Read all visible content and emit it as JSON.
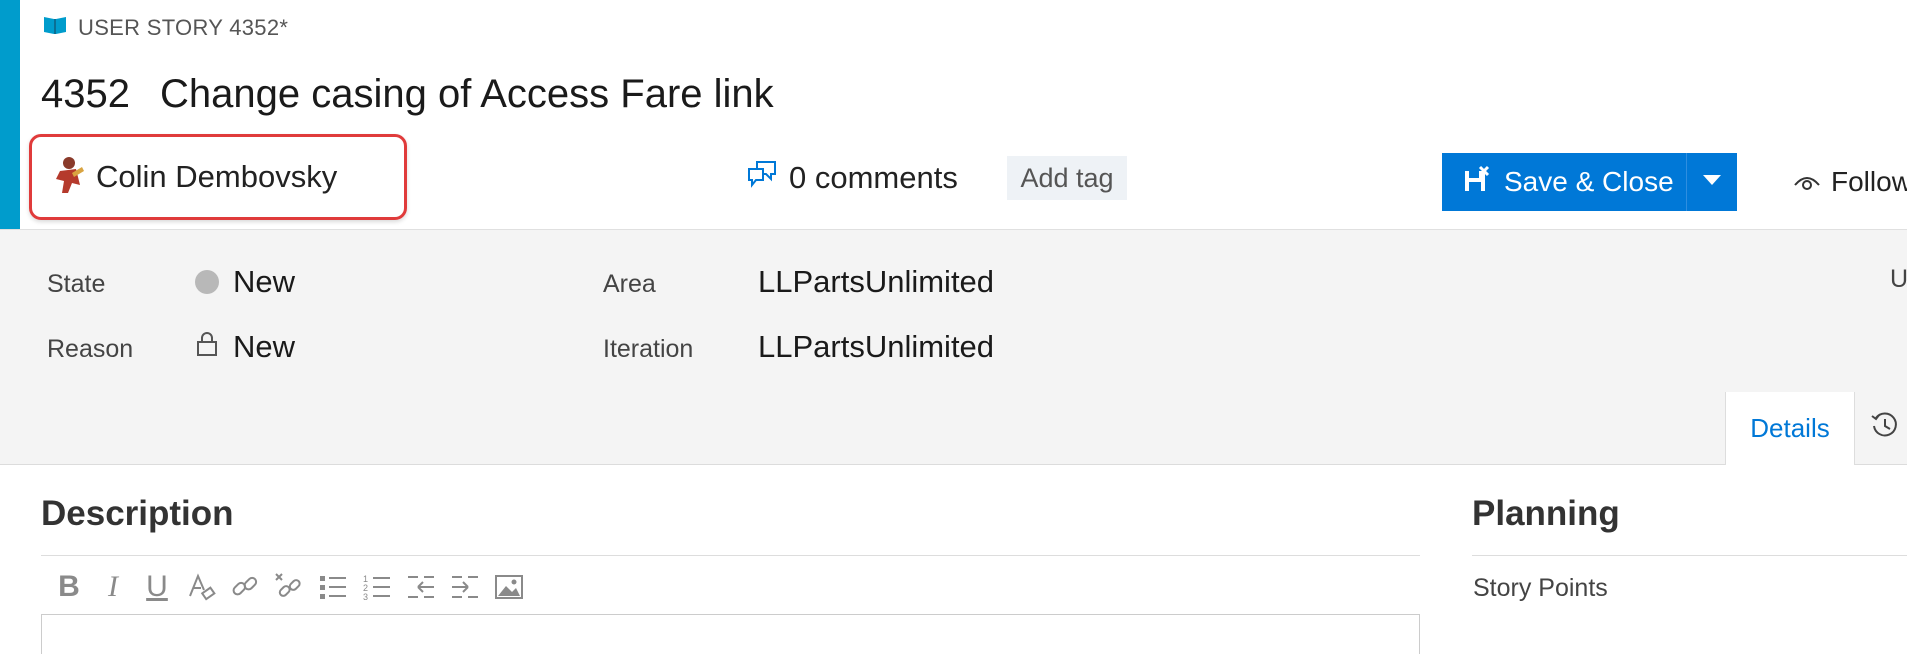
{
  "header": {
    "type_label": "USER STORY 4352*",
    "id": "4352",
    "title": "Change casing of Access Fare link",
    "assignee": "Colin Dembovsky",
    "comments": "0 comments",
    "add_tag": "Add tag",
    "save_label": "Save & Close",
    "follow_label": "Follow"
  },
  "fields": {
    "state_label": "State",
    "state_value": "New",
    "reason_label": "Reason",
    "reason_value": "New",
    "area_label": "Area",
    "area_value": "LLPartsUnlimited",
    "iteration_label": "Iteration",
    "iteration_value": "LLPartsUnlimited",
    "right_cut_label": "U"
  },
  "tabs": {
    "details": "Details"
  },
  "description": {
    "title": "Description"
  },
  "planning": {
    "title": "Planning",
    "story_points_label": "Story Points"
  },
  "colors": {
    "accent": "#009ccc",
    "primary": "#0078d7",
    "highlight": "#e03b3b"
  },
  "icons": [
    "book-icon",
    "avatar",
    "comments-icon",
    "save-icon",
    "chevron-down-icon",
    "eye-icon",
    "lock-icon",
    "history-icon",
    "bold-icon",
    "italic-icon",
    "underline-icon",
    "clear-format-icon",
    "link-icon",
    "unlink-icon",
    "bullet-list-icon",
    "numbered-list-icon",
    "outdent-icon",
    "indent-icon",
    "image-icon"
  ]
}
